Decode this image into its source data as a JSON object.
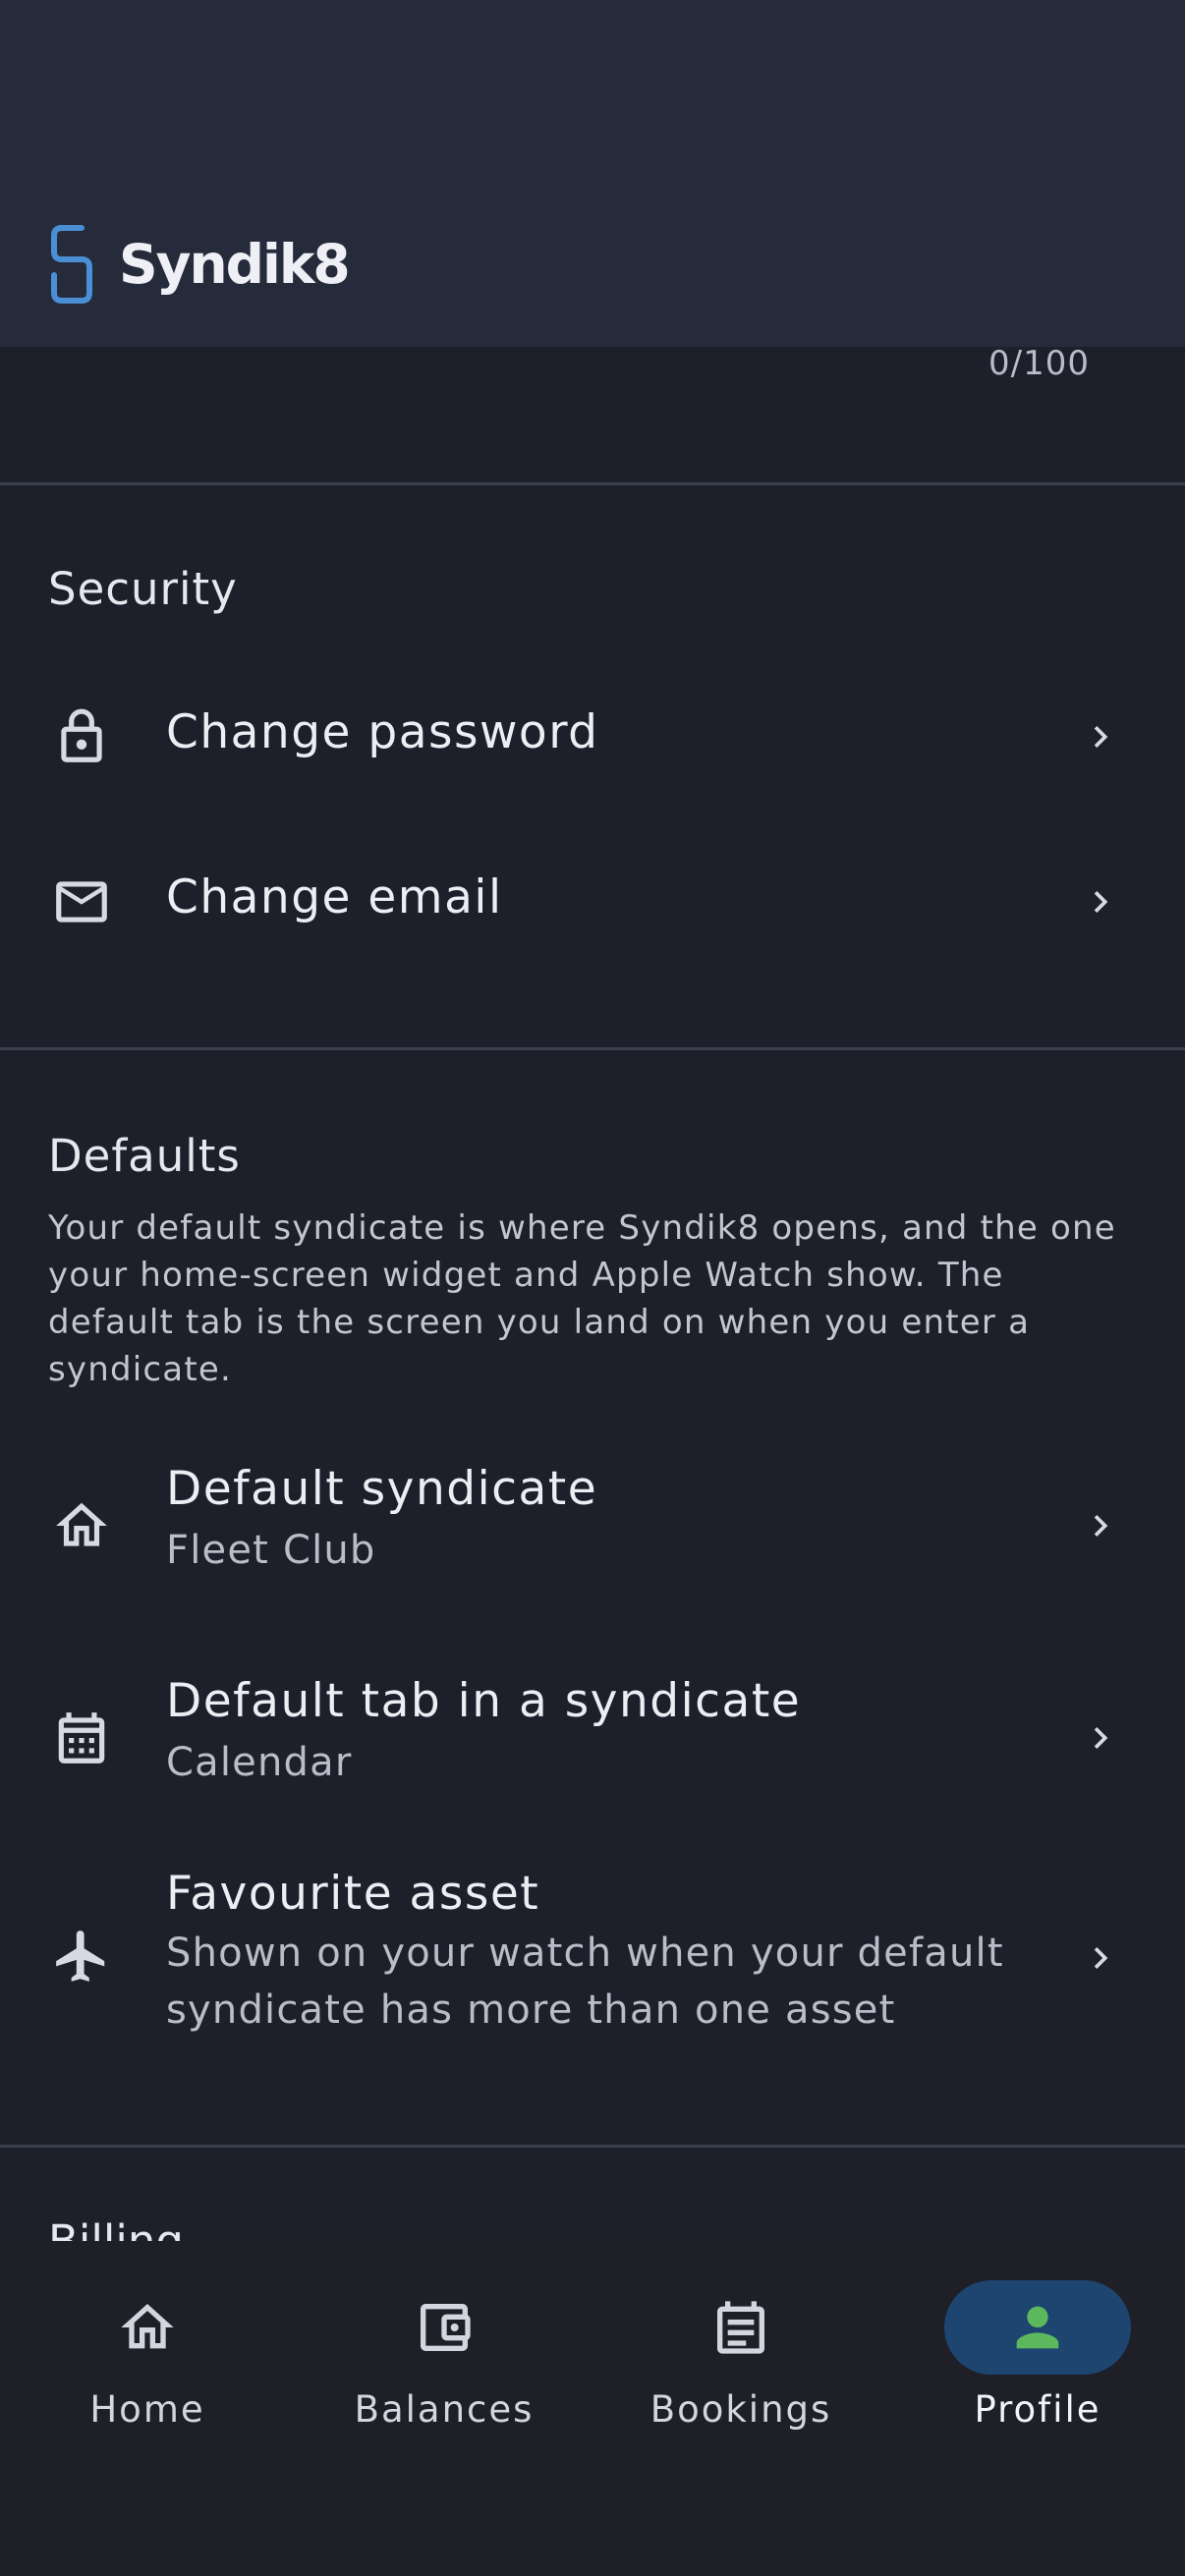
{
  "app": {
    "name": "Syndik8",
    "accent": "#4a8fd6"
  },
  "char_counter": "0/100",
  "security": {
    "title": "Security",
    "items": [
      {
        "label": "Change password",
        "icon": "lock-icon"
      },
      {
        "label": "Change email",
        "icon": "mail-icon"
      }
    ]
  },
  "defaults": {
    "title": "Defaults",
    "description": "Your default syndicate is where Syndik8 opens, and the one your home-screen widget and Apple Watch show. The default tab is the screen you land on when you enter a syndicate.",
    "items": [
      {
        "label": "Default syndicate",
        "value": "Fleet Club",
        "icon": "home-icon"
      },
      {
        "label": "Default tab in a syndicate",
        "value": "Calendar",
        "icon": "calendar-icon"
      },
      {
        "label": "Favourite asset",
        "value": "Shown on your watch when your default syndicate has more than one asset",
        "icon": "airplane-icon"
      }
    ]
  },
  "next_section": {
    "title": "Billing"
  },
  "nav": {
    "items": [
      {
        "label": "Home",
        "icon": "home-icon",
        "active": false
      },
      {
        "label": "Balances",
        "icon": "wallet-icon",
        "active": false
      },
      {
        "label": "Bookings",
        "icon": "bookings-icon",
        "active": false
      },
      {
        "label": "Profile",
        "icon": "person-icon",
        "active": true
      }
    ],
    "active_pill_color": "#1e4470",
    "active_icon_color": "#5cb85c"
  }
}
